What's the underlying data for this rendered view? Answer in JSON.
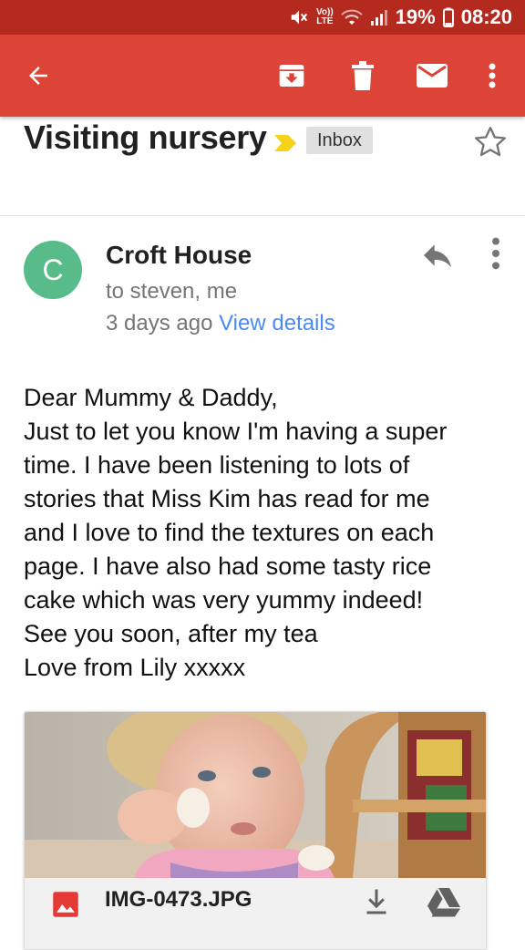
{
  "status_bar": {
    "volte_top": "Vo))",
    "volte_bottom": "LTE",
    "battery": "19%",
    "time": "08:20"
  },
  "toolbar": {
    "back_icon": "arrow-left-icon",
    "archive_icon": "archive-icon",
    "delete_icon": "trash-icon",
    "mark_unread_icon": "envelope-icon",
    "more_icon": "more-vertical-icon"
  },
  "email": {
    "subject": "Visiting nursery",
    "label": "Inbox",
    "sender_initial": "C",
    "sender_name": "Croft House",
    "recipients": "to steven, me",
    "date": "3 days ago",
    "view_details": "View details",
    "body_lines": [
      "Dear Mummy & Daddy,",
      "Just to let you know I'm having a super",
      "time. I have been listening to lots of",
      "stories that Miss Kim has read for me",
      "and I love to find the textures on each",
      "page. I have also had some tasty rice",
      "cake which was very yummy indeed!",
      "See you soon, after my tea",
      "Love from Lily xxxxx"
    ]
  },
  "attachment": {
    "file_name": "IMG-0473.JPG"
  },
  "colors": {
    "status_bar": "#b42a1f",
    "app_bar": "#db4437",
    "avatar": "#57bb8a",
    "link": "#4a8af4",
    "important": "#f6d21b"
  }
}
